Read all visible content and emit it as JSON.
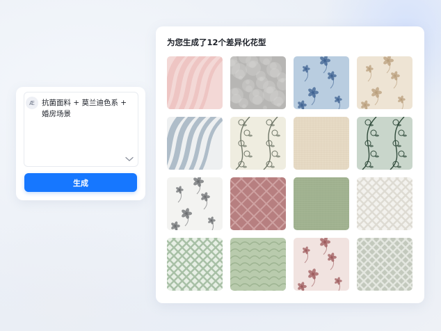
{
  "prompt": {
    "avatar_text": "Æ",
    "text": "抗菌面料 + 莫兰迪色系 + 婚房场景",
    "generate_label": "生成"
  },
  "results": {
    "title": "为您生成了12个差异化花型",
    "patterns": [
      {
        "name": "pink-wave-pattern",
        "style": "waves",
        "bg": "#f3d8d6",
        "fg": "#e9b7b5"
      },
      {
        "name": "grey-marble-floral-pattern",
        "style": "mottled",
        "bg": "#b7b6b4",
        "fg": "#d7d6d3"
      },
      {
        "name": "blue-floral-pattern",
        "style": "floral",
        "bg": "#b9cde0",
        "fg": "#3f6291"
      },
      {
        "name": "beige-floral-pattern",
        "style": "floral",
        "bg": "#eee4d4",
        "fg": "#b99f7c"
      },
      {
        "name": "blue-grey-wave-pattern",
        "style": "waves",
        "bg": "#eef0f1",
        "fg": "#7c93a8"
      },
      {
        "name": "cream-vine-pattern",
        "style": "vine",
        "bg": "#efede0",
        "fg": "#6e7566"
      },
      {
        "name": "linen-texture-pattern",
        "style": "linen",
        "bg": "#e8dcc7",
        "fg": "#d9cab1"
      },
      {
        "name": "sage-vine-pattern",
        "style": "vine",
        "bg": "#c9d6cb",
        "fg": "#2f4a3a"
      },
      {
        "name": "white-sketch-floral-pattern",
        "style": "floral",
        "bg": "#f3f3f1",
        "fg": "#6b6d70"
      },
      {
        "name": "rose-lattice-pattern",
        "style": "lattice",
        "bg": "#b77f80",
        "fg": "#cfa2a2"
      },
      {
        "name": "sage-linen-pattern",
        "style": "linen",
        "bg": "#9daf8c",
        "fg": "#b3c2a3"
      },
      {
        "name": "white-fret-pattern",
        "style": "fret",
        "bg": "#f3f2ee",
        "fg": "#dedbd3"
      },
      {
        "name": "mint-trellis-pattern",
        "style": "fret",
        "bg": "#e7efe5",
        "fg": "#a8c0a6"
      },
      {
        "name": "green-leaf-texture-pattern",
        "style": "leaf",
        "bg": "#b9cbad",
        "fg": "#9db491"
      },
      {
        "name": "pink-rose-floral-pattern",
        "style": "floral",
        "bg": "#f1e3e0",
        "fg": "#9d5a5c"
      },
      {
        "name": "grey-green-fret-pattern",
        "style": "fret",
        "bg": "#c3c9bd",
        "fg": "#e4e7e0"
      }
    ]
  }
}
